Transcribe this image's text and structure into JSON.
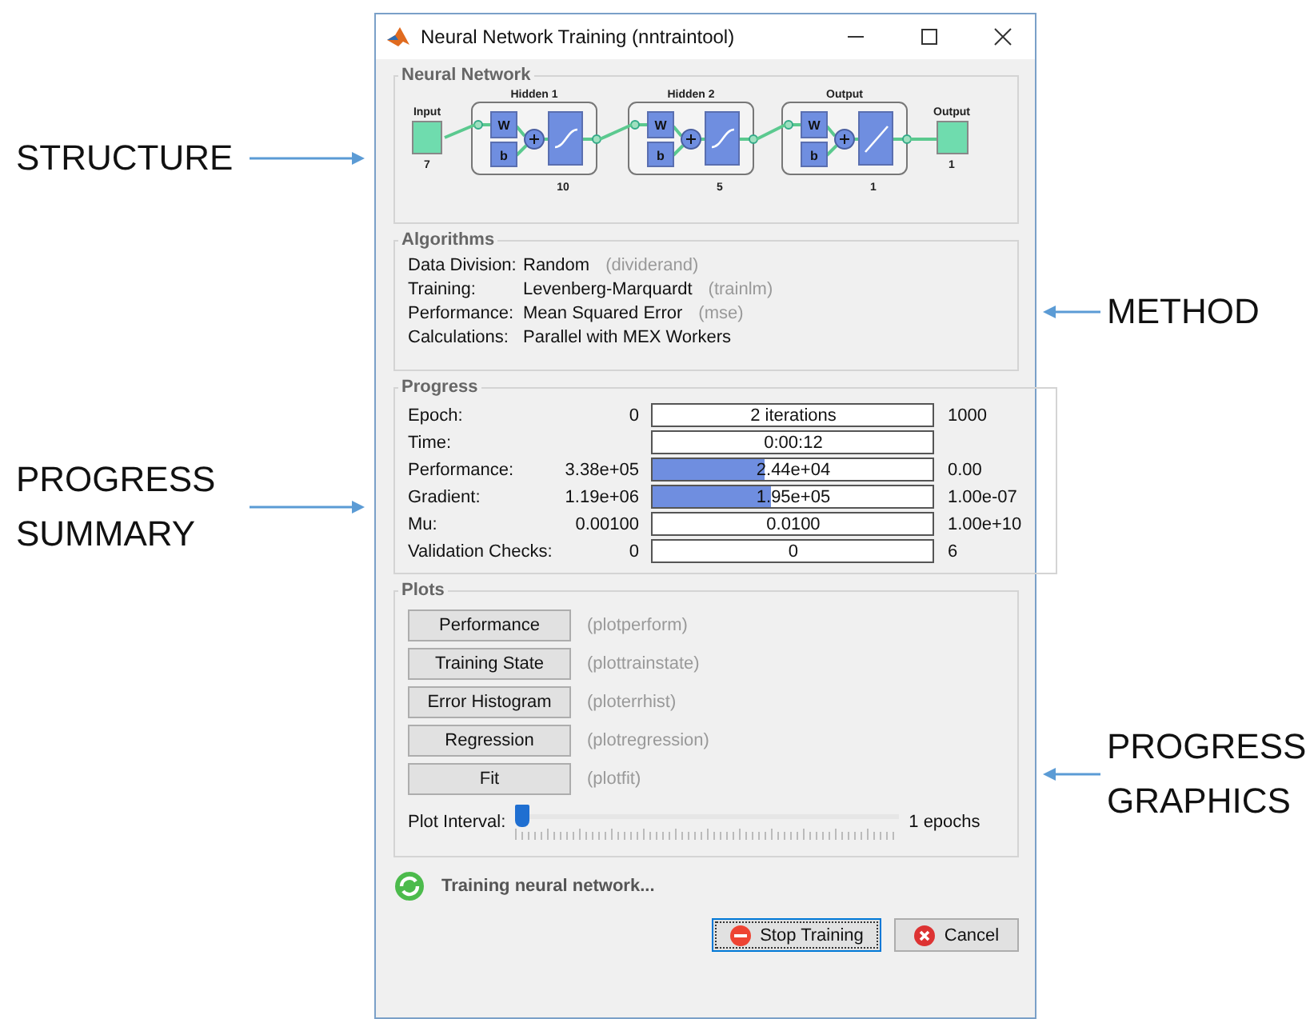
{
  "left_annotations": [
    {
      "text": "STRUCTURE"
    },
    {
      "text": "PROGRESS SUMMARY"
    }
  ],
  "right_annotations": [
    {
      "text": "METHOD"
    },
    {
      "text": "PROGRESS GRAPHICS"
    }
  ],
  "window": {
    "title": "Neural Network Training (nntraintool)"
  },
  "network": {
    "heading": "Neural Network",
    "input": {
      "label": "Input",
      "size": "7"
    },
    "layers": [
      {
        "title": "Hidden 1",
        "size": "10",
        "kind": "sigmoid",
        "weight": "W",
        "bias": "b"
      },
      {
        "title": "Hidden 2",
        "size": "5",
        "kind": "sigmoid",
        "weight": "W",
        "bias": "b"
      },
      {
        "title": "Output",
        "size": "1",
        "kind": "linear",
        "weight": "W",
        "bias": "b"
      }
    ],
    "output": {
      "label": "Output",
      "size": "1"
    }
  },
  "algorithms": {
    "heading": "Algorithms",
    "rows": [
      {
        "label": "Data Division:",
        "value": "Random",
        "func": "(dividerand)"
      },
      {
        "label": "Training:",
        "value": "Levenberg-Marquardt",
        "func": "(trainlm)"
      },
      {
        "label": "Performance:",
        "value": "Mean Squared Error",
        "func": "(mse)"
      },
      {
        "label": "Calculations:",
        "value": "Parallel with MEX Workers"
      }
    ]
  },
  "progress": {
    "heading": "Progress",
    "rows": [
      {
        "label": "Epoch:",
        "min": "0",
        "value": "2 iterations",
        "max": "1000"
      },
      {
        "label": "Time:",
        "value": "0:00:12"
      },
      {
        "label": "Performance:",
        "min": "3.38e+05",
        "value": "2.44e+04",
        "max": "0.00",
        "level": 0.4
      },
      {
        "label": "Gradient:",
        "min": "1.19e+06",
        "value": "1.95e+05",
        "max": "1.00e-07",
        "level": 0.42
      },
      {
        "label": "Mu:",
        "min": "0.00100",
        "value": "0.0100",
        "max": "1.00e+10"
      },
      {
        "label": "Validation Checks:",
        "min": "0",
        "value": "0",
        "max": "6"
      }
    ]
  },
  "plots": {
    "heading": "Plots",
    "buttons": [
      {
        "label": "Performance",
        "func": "(plotperform)"
      },
      {
        "label": "Training State",
        "func": "(plottrainstate)"
      },
      {
        "label": "Error Histogram",
        "func": "(ploterrhist)"
      },
      {
        "label": "Regression",
        "func": "(plotregression)"
      },
      {
        "label": "Fit",
        "func": "(plotfit)"
      }
    ],
    "interval": {
      "label": "Plot Interval:",
      "level": 0,
      "reading": "1 epochs"
    }
  },
  "status": "Training neural network...",
  "buttons": [
    {
      "label": "Stop Training",
      "kind": "stop",
      "focused": true
    },
    {
      "label": "Cancel",
      "kind": "cancel",
      "focused": false
    }
  ]
}
